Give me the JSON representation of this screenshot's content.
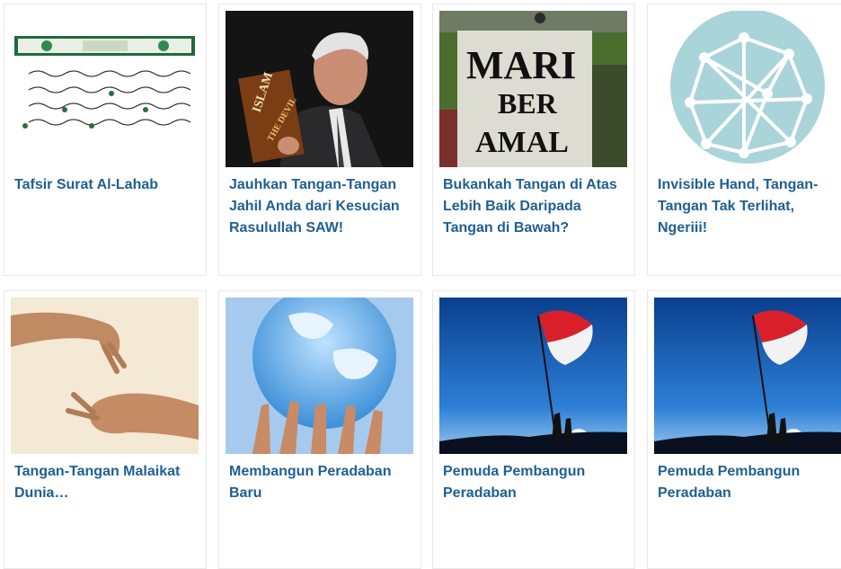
{
  "articles": [
    {
      "title": "Tafsir Surat Al-Lahab",
      "image": "quran-page-image"
    },
    {
      "title": "Jauhkan Tangan-Tangan Jahil Anda dari Kesucian Rasulullah SAW!",
      "image": "man-holding-book-image",
      "book_text": "ISLAM",
      "book_text_2": "THE DEVIL"
    },
    {
      "title": "Bukankah Tangan di Atas Lebih Baik Daripada Tangan di Bawah?",
      "image": "charity-sign-image",
      "sign_lines": [
        "MARI",
        "BER",
        "AMAL"
      ]
    },
    {
      "title": "Invisible Hand, Tangan-Tangan Tak Terlihat, Ngeriii!",
      "image": "network-icon-image"
    },
    {
      "title": "Tangan-Tangan Malaikat Dunia…",
      "image": "reaching-hands-image"
    },
    {
      "title": "Membangun Peradaban Baru",
      "image": "hands-holding-globe-image"
    },
    {
      "title": "Pemuda Pembangun Peradaban",
      "image": "flag-silhouette-image"
    },
    {
      "title": "Pemuda Pembangun Peradaban",
      "image": "flag-silhouette-image"
    }
  ],
  "colors": {
    "title": "#1f5f93",
    "border": "#e8e8e8",
    "network_bg": "#a9d4d9"
  }
}
